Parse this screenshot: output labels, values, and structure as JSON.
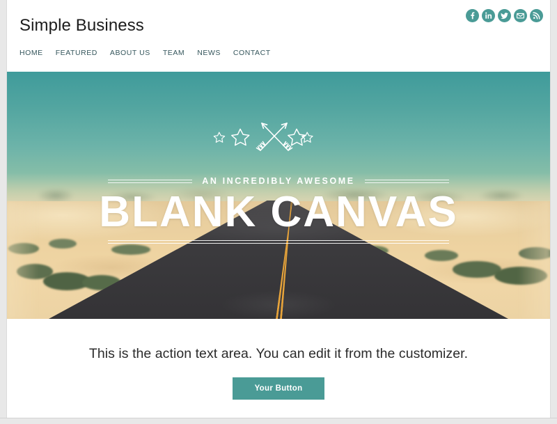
{
  "site": {
    "title": "Simple Business"
  },
  "social": {
    "items": [
      {
        "name": "facebook-icon",
        "label": "Facebook",
        "glyph": "f"
      },
      {
        "name": "linkedin-icon",
        "label": "LinkedIn",
        "glyph": "in"
      },
      {
        "name": "twitter-icon",
        "label": "Twitter",
        "glyph": "bird"
      },
      {
        "name": "email-icon",
        "label": "Email",
        "glyph": "envelope"
      },
      {
        "name": "rss-icon",
        "label": "RSS",
        "glyph": "rss"
      }
    ],
    "color": "#4a9b96"
  },
  "nav": {
    "items": [
      {
        "label": "HOME"
      },
      {
        "label": "FEATURED"
      },
      {
        "label": "ABOUT US"
      },
      {
        "label": "TEAM"
      },
      {
        "label": "NEWS"
      },
      {
        "label": "CONTACT"
      }
    ],
    "color": "#35565c"
  },
  "hero": {
    "emblem": "crossed-arrows-and-stars",
    "tagline": "AN INCREDIBLY AWESOME",
    "title": "BLANK CANVAS",
    "image_alt": "Desert road between sand dunes at dusk"
  },
  "action": {
    "text": "This is the action text area. You can edit it from the customizer.",
    "button_label": "Your Button",
    "button_color": "#4a9b96"
  }
}
